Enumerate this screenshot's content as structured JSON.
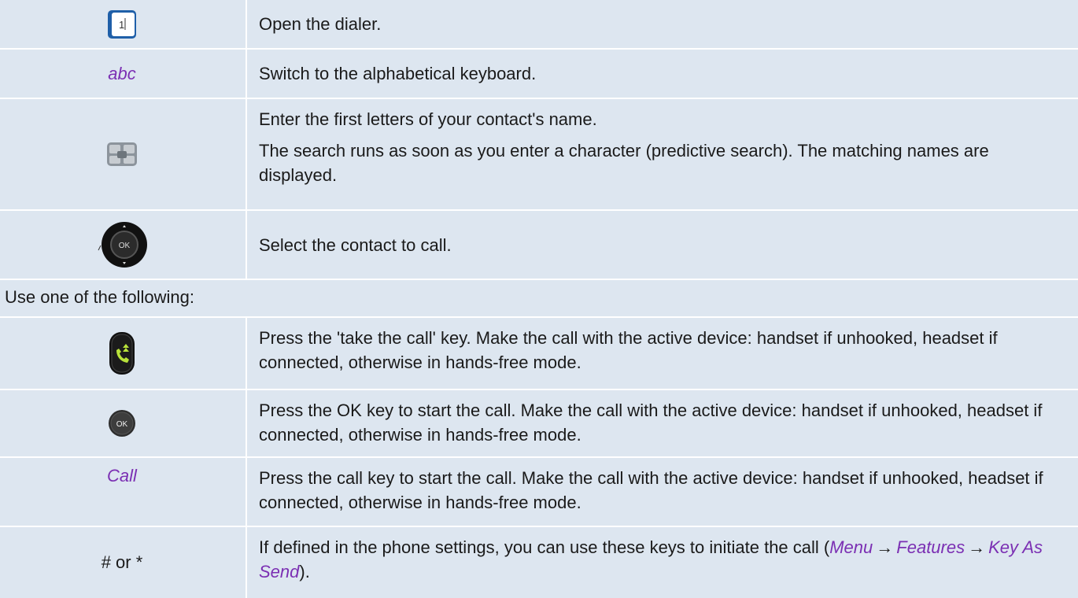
{
  "rows": [
    {
      "icon": "dialer-key-icon",
      "description": "Open the dialer."
    },
    {
      "keyword": "abc",
      "description": "Switch to the alphabetical keyboard."
    },
    {
      "icon": "alphabet-keyboard-icon",
      "lines": [
        "Enter the first letters of your contact's name.",
        "The search runs as soon as you enter a character (predictive search). The matching names are displayed."
      ]
    },
    {
      "icon": "navigator-ok-icon",
      "description": "Select the contact to call."
    }
  ],
  "section": {
    "label": "Use one of the following:"
  },
  "options": [
    {
      "icon": "take-call-key-icon",
      "description": "Press the 'take the call' key. Make the call with the active device: handset if unhooked, headset if connected, otherwise in hands-free mode."
    },
    {
      "icon": "ok-key-icon",
      "icon_label": "OK",
      "description": "Press the OK key to start the call. Make the call with the active device: handset if unhooked, headset if connected, otherwise in hands-free mode."
    },
    {
      "keyword": "Call",
      "description": "Press the call key to start the call. Make the call with the active device: handset if unhooked, headset if connected, otherwise in hands-free mode."
    },
    {
      "keys": "# or *",
      "description_prefix": "If defined in the phone settings, you can use these keys to initiate the call (",
      "path": [
        "Menu",
        "Features",
        "Key As Send"
      ],
      "arrow": "→",
      "description_suffix": ")."
    }
  ],
  "icon_texts": {
    "dialer": "1",
    "navigator": "OK"
  },
  "colors": {
    "row_bg": "#dde6f0",
    "keyword": "#7b2fb3",
    "key_green": "#b8e23a"
  }
}
